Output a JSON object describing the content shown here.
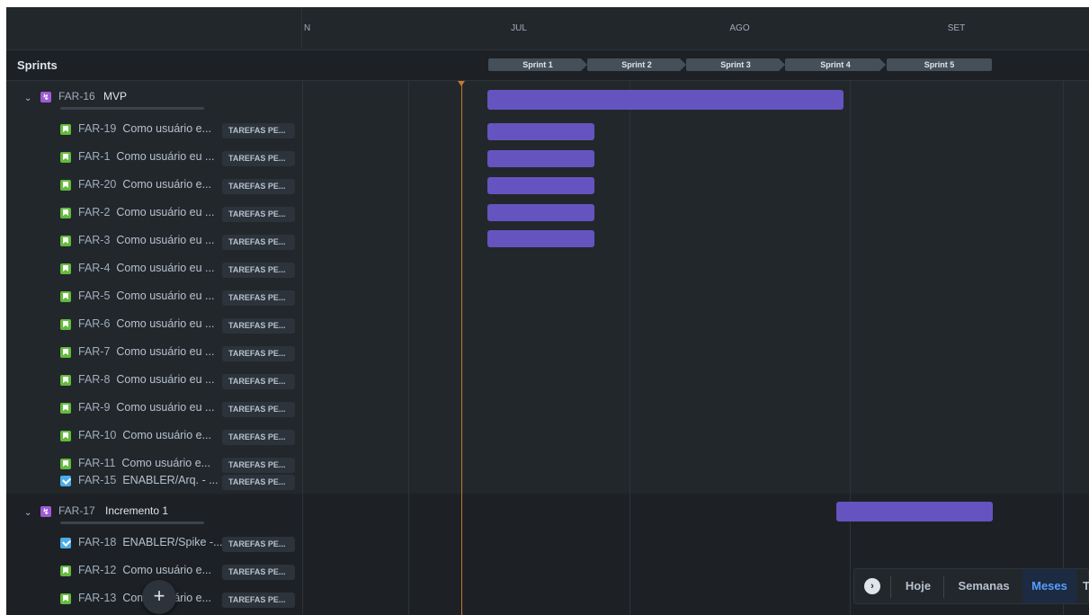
{
  "header": {
    "months": [
      "JUL",
      "AGO",
      "SET"
    ],
    "cut_month": "N"
  },
  "sprint_row": {
    "title": "Sprints",
    "sprints": [
      "Sprint 1",
      "Sprint 2",
      "Sprint 3",
      "Sprint 4",
      "Sprint 5"
    ]
  },
  "status_label": "TAREFAS PE...",
  "epics": [
    {
      "key": "FAR-16",
      "title": "MVP",
      "items": [
        {
          "key": "FAR-19",
          "title": "Como usuário e...",
          "type": "story"
        },
        {
          "key": "FAR-1",
          "title": "Como usuário eu ...",
          "type": "story"
        },
        {
          "key": "FAR-20",
          "title": "Como usuário e...",
          "type": "story"
        },
        {
          "key": "FAR-2",
          "title": "Como usuário eu ...",
          "type": "story"
        },
        {
          "key": "FAR-3",
          "title": "Como usuário eu ...",
          "type": "story"
        },
        {
          "key": "FAR-4",
          "title": "Como usuário eu ...",
          "type": "story"
        },
        {
          "key": "FAR-5",
          "title": "Como usuário eu ...",
          "type": "story"
        },
        {
          "key": "FAR-6",
          "title": "Como usuário eu ...",
          "type": "story"
        },
        {
          "key": "FAR-7",
          "title": "Como usuário eu ...",
          "type": "story"
        },
        {
          "key": "FAR-8",
          "title": "Como usuário eu ...",
          "type": "story"
        },
        {
          "key": "FAR-9",
          "title": "Como usuário eu ...",
          "type": "story"
        },
        {
          "key": "FAR-10",
          "title": "Como usuário e...",
          "type": "story"
        },
        {
          "key": "FAR-11",
          "title": "Como usuário e...",
          "type": "story"
        },
        {
          "key": "FAR-15",
          "title": "ENABLER/Arq. - ...",
          "type": "task"
        }
      ]
    },
    {
      "key": "FAR-17",
      "title": "Incremento 1",
      "items": [
        {
          "key": "FAR-18",
          "title": "ENABLER/Spike -...",
          "type": "task"
        },
        {
          "key": "FAR-12",
          "title": "Como usuário e...",
          "type": "story"
        },
        {
          "key": "FAR-13",
          "title": "Como usuário e...",
          "type": "story"
        }
      ]
    }
  ],
  "fab_label": "+",
  "zoom": {
    "arrow": "›",
    "today": "Hoje",
    "weeks": "Semanas",
    "months": "Meses",
    "cut": "T",
    "active": "Meses"
  },
  "colors": {
    "bar": "#6554c0",
    "today_line": "#c7782c",
    "story_icon": "#63ba3c",
    "task_icon": "#4bade8",
    "epic_icon": "#9f5bd6"
  },
  "icons": {
    "expand": "chevron-down-icon",
    "epic": "epic-lightning-icon",
    "story": "story-bookmark-icon",
    "task": "task-checkbox-icon"
  }
}
